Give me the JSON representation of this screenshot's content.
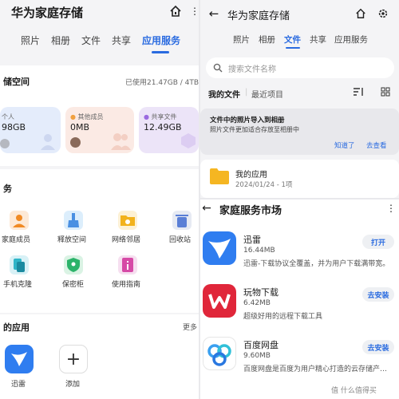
{
  "left": {
    "title": "华为家庭存储",
    "tabs": [
      "照片",
      "相册",
      "文件",
      "共享",
      "应用服务"
    ],
    "storage": {
      "heading": "储空间",
      "used": "已使用21.47GB / 4TB"
    },
    "cards": [
      {
        "label": "个人",
        "value": "98GB"
      },
      {
        "label": "其他成员",
        "value": "0MB"
      },
      {
        "label": "共享文件",
        "value": "12.49GB"
      }
    ],
    "services_heading": "务",
    "services": [
      "家庭成员",
      "释放空间",
      "网络邻居",
      "回收站",
      "手机克隆",
      "保密柜",
      "使用指南"
    ],
    "my_apps": {
      "heading": "的应用",
      "more": "更多",
      "apps": [
        "迅雷",
        "添加"
      ]
    }
  },
  "right_top": {
    "title": "华为家庭存储",
    "tabs": [
      "照片",
      "相册",
      "文件",
      "共享",
      "应用服务"
    ],
    "search_placeholder": "搜索文件名称",
    "subtabs": [
      "我的文件",
      "最近项目"
    ],
    "notice": {
      "title": "文件中的照片导入到相册",
      "text": "照片文件更加适合存放至相册中",
      "dismiss": "知道了",
      "go": "去查看"
    },
    "folder": {
      "name": "我的应用",
      "meta": "2024/01/24 - 1项"
    }
  },
  "right_bottom": {
    "title": "家庭服务市场",
    "apps": [
      {
        "name": "迅雷",
        "size": "16.44MB",
        "desc": "迅雷-下载协议全覆盖，并为用户下载满带宽。",
        "action": "打开"
      },
      {
        "name": "玩物下载",
        "size": "6.42MB",
        "desc": "超级好用的远程下载工具",
        "action": "去安装"
      },
      {
        "name": "百度网盘",
        "size": "9.60MB",
        "desc": "百度网盘是百度为用户精心打造的云存储产…",
        "action": "去安装"
      }
    ],
    "watermark": "值 什么值得买"
  },
  "colors": {
    "accent": "#2a6be0",
    "xunlei": "#2f7df0",
    "wanwu": "#e0263a",
    "baidu": "#3aa0f0"
  }
}
